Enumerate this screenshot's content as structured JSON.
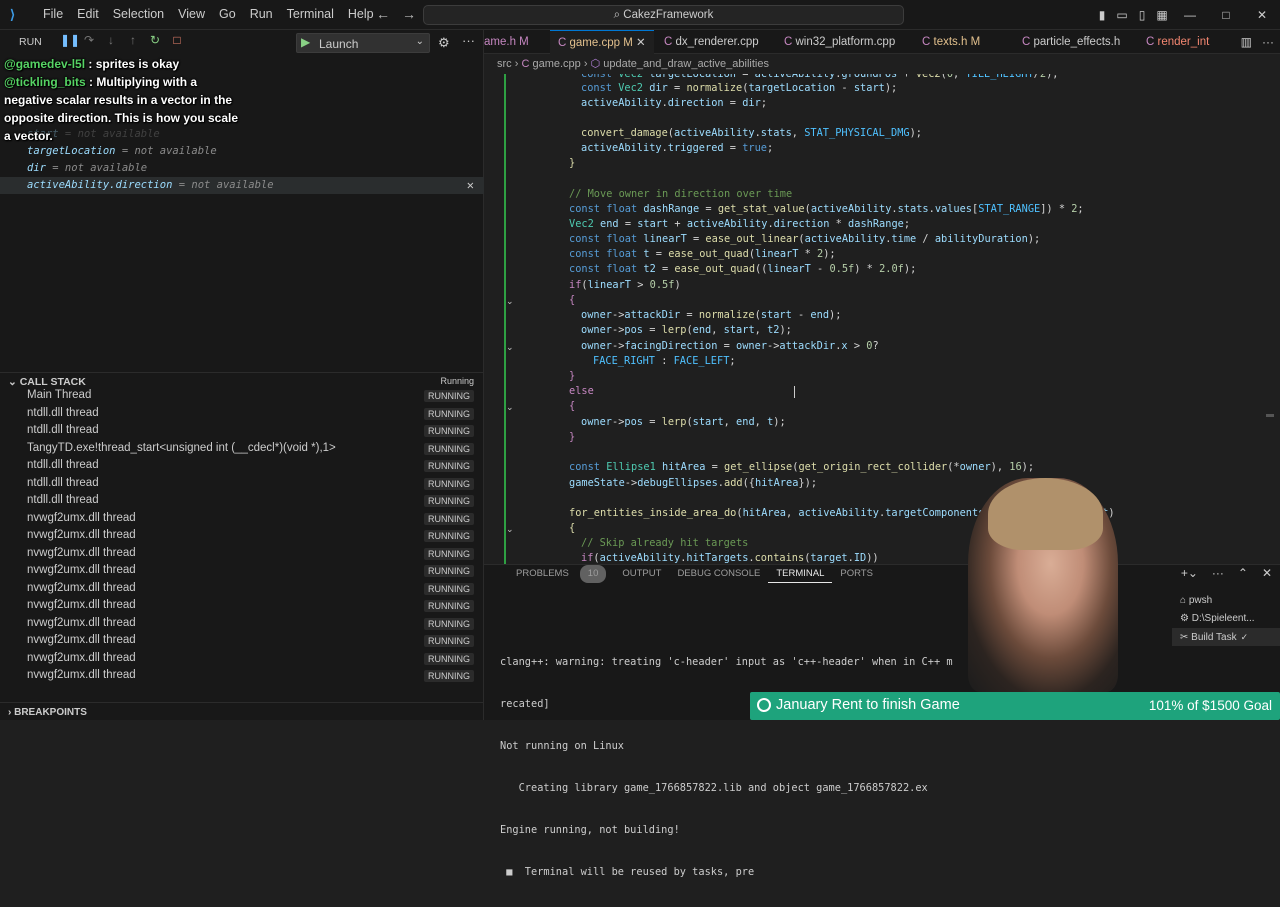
{
  "titlebar": {
    "logo": "⟩",
    "menu": [
      "File",
      "Edit",
      "Selection",
      "View",
      "Go",
      "Run",
      "Terminal",
      "Help"
    ],
    "search": "CakezFramework"
  },
  "debug": {
    "run_label": "RUN",
    "launch_label": "Launch"
  },
  "chat": [
    {
      "user": "@gamedev-l5l",
      "text": " : sprites is okay"
    },
    {
      "user": "@tickling_bits",
      "text": " : Multiplying with a negative scalar results in a vector in the opposite direction. This is how you scale a vector."
    }
  ],
  "watch": [
    {
      "name": "start",
      "value": " = not available"
    },
    {
      "name": "targetLocation",
      "value": " = not available"
    },
    {
      "name": "dir",
      "value": " = not available"
    },
    {
      "name": "activeAbility.direction",
      "value": " = not available"
    }
  ],
  "callstack": {
    "title": "CALL STACK",
    "status": "Running",
    "threads": [
      "Main Thread",
      "ntdll.dll thread",
      "ntdll.dll thread",
      "TangyTD.exe!thread_start<unsigned int (__cdecl*)(void *),1>",
      "ntdll.dll thread",
      "ntdll.dll thread",
      "ntdll.dll thread",
      "nvwgf2umx.dll thread",
      "nvwgf2umx.dll thread",
      "nvwgf2umx.dll thread",
      "nvwgf2umx.dll thread",
      "nvwgf2umx.dll thread",
      "nvwgf2umx.dll thread",
      "nvwgf2umx.dll thread",
      "nvwgf2umx.dll thread",
      "nvwgf2umx.dll thread",
      "nvwgf2umx.dll thread"
    ],
    "badge": "RUNNING"
  },
  "breakpoints_title": "BREAKPOINTS",
  "tabs": [
    {
      "name": "ame.h",
      "mod": "M",
      "color": "#c586c0"
    },
    {
      "name": "game.cpp",
      "mod": "M",
      "color": "#e2c08d"
    },
    {
      "name": "dx_renderer.cpp",
      "mod": "",
      "color": "#cccccc"
    },
    {
      "name": "win32_platform.cpp",
      "mod": "",
      "color": "#cccccc"
    },
    {
      "name": "texts.h",
      "mod": "M",
      "color": "#e2c08d"
    },
    {
      "name": "particle_effects.h",
      "mod": "",
      "color": "#cccccc"
    },
    {
      "name": "render_int",
      "mod": "",
      "color": "#f48771"
    }
  ],
  "breadcrumb": [
    "src",
    "game.cpp",
    "update_and_draw_active_abilities"
  ],
  "panel": {
    "tabs": [
      "PROBLEMS",
      "OUTPUT",
      "DEBUG CONSOLE",
      "TERMINAL",
      "PORTS"
    ],
    "problems_count": "10",
    "terminal_lines": [
      "clang++: warning: treating 'c-header' input as 'c++-header' when in C++ m",
      "recated]",
      "Not running on Linux",
      "   Creating library game_1766857822.lib and object game_1766857822.ex",
      "Engine running, not building!",
      " ■  Terminal will be reused by tasks, pre"
    ],
    "terminals": [
      "pwsh",
      "D:\\Spieleent...",
      "Build  Task"
    ]
  },
  "goal": {
    "title": "January Rent to finish Game",
    "progress": "101% of $1500 Goal"
  }
}
